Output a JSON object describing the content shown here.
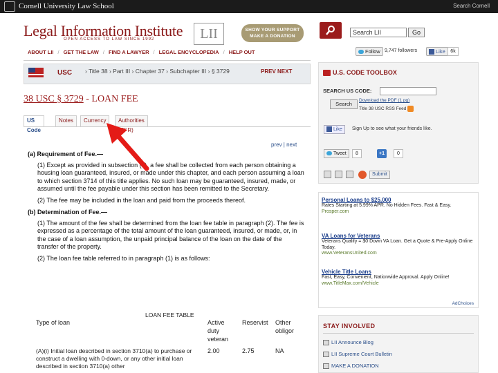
{
  "topbar": {
    "university": "Cornell University Law School",
    "search_link": "Search Cornell"
  },
  "header": {
    "title": "Legal Information Institute",
    "tagline": "OPEN ACCESS TO LAW SINCE 1992",
    "logo": "LII",
    "donate_line1": "SHOW YOUR SUPPORT",
    "donate_line2": "MAKE A DONATION",
    "search_value": "Search LII",
    "go_label": "Go"
  },
  "nav": {
    "items": [
      "ABOUT LII",
      "GET THE LAW",
      "FIND A LAWYER",
      "LEGAL ENCYCLOPEDIA",
      "HELP OUT"
    ],
    "separator": "/"
  },
  "social_top": {
    "follow_label": "Follow",
    "followers": "9,747 followers",
    "like_label": "Like",
    "like_count": "6k"
  },
  "breadcrumb": {
    "code": "USC",
    "path": "› Title 38 › Part III › Chapter 37 › Subchapter III › § 3729",
    "prev_next": "PREV NEXT"
  },
  "section": {
    "cite": "38 USC § 3729",
    "name": " - LOAN FEE"
  },
  "tabs": [
    {
      "label": "US Code",
      "active": true
    },
    {
      "label": "Notes",
      "active": false
    },
    {
      "label": "Currency",
      "active": false
    },
    {
      "label": "Authorities (CFR)",
      "active": false
    }
  ],
  "pager": "prev | next",
  "body": {
    "a_head": "(a) Requirement of Fee.—",
    "a1": "(1) Except as provided in subsection (c), a fee shall be collected from each person obtaining a housing loan guaranteed, insured, or made under this chapter, and each person assuming a loan to which section 3714 of this title applies. No such loan may be guaranteed, insured, made, or assumed until the fee payable under this section has been remitted to the Secretary.",
    "a2": "(2) The fee may be included in the loan and paid from the proceeds thereof.",
    "b_head": "(b) Determination of Fee.—",
    "b1": "(1) The amount of the fee shall be determined from the loan fee table in paragraph (2). The fee is expressed as a percentage of the total amount of the loan guaranteed, insured, or made, or, in the case of a loan assumption, the unpaid principal balance of the loan on the date of the transfer of the property.",
    "b2": "(2) The loan fee table referred to in paragraph (1) is as follows:"
  },
  "loan_table": {
    "title": "LOAN FEE TABLE",
    "headers": [
      "Type of loan",
      "Active duty veteran",
      "Reservist",
      "Other obligor"
    ],
    "rows": [
      {
        "type": "(A)(i) Initial loan described in section 3710(a) to purchase or construct a dwelling with 0-down, or any other initial loan described in section 3710(a) other",
        "active": "2.00",
        "reservist": "2.75",
        "other": "NA"
      }
    ]
  },
  "toolbox": {
    "title": "U.S. CODE TOOLBOX",
    "search_label": "SEARCH US CODE:",
    "search_button": "Search",
    "download": "Download the PDF (1 pg)",
    "rss": "Title 38 USC RSS Feed",
    "like_label": "Like",
    "like_text": "Sign Up to see what your friends like.",
    "tweet_label": "Tweet",
    "tweet_count": "8",
    "gplus_label": "+1",
    "gplus_count": "0",
    "submit_label": "Submit"
  },
  "ads": [
    {
      "title": "Personal Loans to $25,000",
      "desc": "Rates Starting at 5.99% APR. No Hidden Fees. Fast & Easy.",
      "url": "Prosper.com"
    },
    {
      "title": "VA Loans for Veterans",
      "desc": "Veterans Qualify = $0 Down VA Loan. Get a Quote & Pre-Apply Online Today.",
      "url": "www.VeteransUnited.com"
    },
    {
      "title": "Vehicle Title Loans",
      "desc": "Fast, Easy, Convenient, Nationwide Approval. Apply Online!",
      "url": "www.TitleMax.com/Vehicle"
    }
  ],
  "adchoices": "AdChoices",
  "involved": {
    "title": "STAY INVOLVED",
    "items": [
      "LII Announce Blog",
      "LII Supreme Court Bulletin",
      "MAKE A DONATION"
    ]
  },
  "colors": {
    "brand_red": "#8b1a1a",
    "arrow_red": "#e41b17",
    "link_blue": "#2b4f8a"
  }
}
